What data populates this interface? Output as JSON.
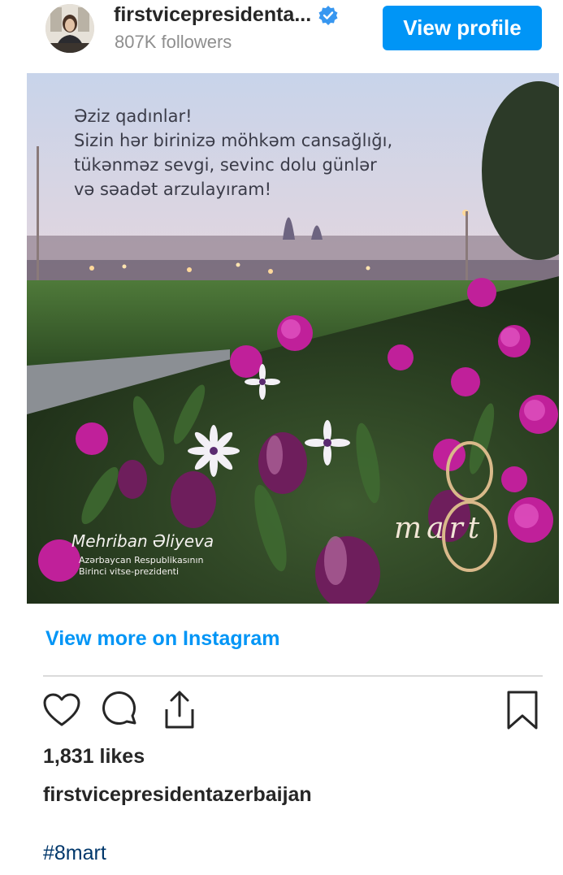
{
  "header": {
    "username": "firstvicepresidenta...",
    "followers": "807K followers",
    "view_profile_label": "View profile"
  },
  "post_image": {
    "greeting_lines": [
      "Əziz qadınlar!",
      "Sizin hər birinizə möhkəm cansağlığı,",
      "tükənməz sevgi, sevinc dolu günlər",
      "və səadət arzulayıram!"
    ],
    "signature_name": "Mehriban Əliyeva",
    "signature_title_line1": "Azərbaycan Respublikasının",
    "signature_title_line2": "Birinci vitse-prezidenti",
    "badge_number": "8",
    "badge_word": "mart"
  },
  "view_more_label": "View more on Instagram",
  "actions": {
    "icons": [
      "heart-icon",
      "comment-icon",
      "share-icon",
      "bookmark-icon"
    ]
  },
  "likes": "1,831 likes",
  "caption_username": "firstvicepresidentazerbaijan",
  "hashtag": "#8mart",
  "colors": {
    "accent_blue": "#0095f6",
    "hashtag_blue": "#00376b",
    "text": "#262626",
    "muted": "#8e8e8e"
  }
}
